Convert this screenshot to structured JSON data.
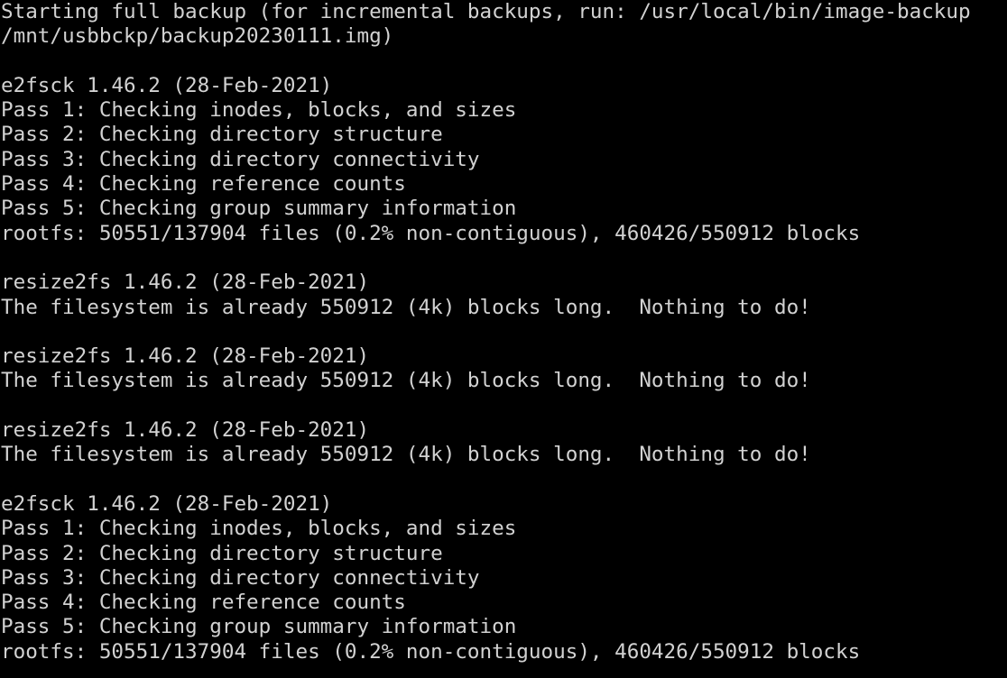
{
  "terminal": {
    "background_color": "#000000",
    "foreground_color": "#d2d2d2",
    "lines": [
      {
        "id": "backup-header-1",
        "text": "Starting full backup (for incremental backups, run: /usr/local/bin/image-backup"
      },
      {
        "id": "backup-header-2",
        "text": "/mnt/usbbckp/backup20230111.img)"
      },
      {
        "id": "blank-1",
        "text": ""
      },
      {
        "id": "e2fsck-version-1",
        "text": "e2fsck 1.46.2 (28-Feb-2021)"
      },
      {
        "id": "e2fsck1-pass-1",
        "text": "Pass 1: Checking inodes, blocks, and sizes"
      },
      {
        "id": "e2fsck1-pass-2",
        "text": "Pass 2: Checking directory structure"
      },
      {
        "id": "e2fsck1-pass-3",
        "text": "Pass 3: Checking directory connectivity"
      },
      {
        "id": "e2fsck1-pass-4",
        "text": "Pass 4: Checking reference counts"
      },
      {
        "id": "e2fsck1-pass-5",
        "text": "Pass 5: Checking group summary information"
      },
      {
        "id": "e2fsck1-summary",
        "text": "rootfs: 50551/137904 files (0.2% non-contiguous), 460426/550912 blocks"
      },
      {
        "id": "blank-2",
        "text": ""
      },
      {
        "id": "resize2fs-version-1",
        "text": "resize2fs 1.46.2 (28-Feb-2021)"
      },
      {
        "id": "resize2fs-result-1",
        "text": "The filesystem is already 550912 (4k) blocks long.  Nothing to do!"
      },
      {
        "id": "blank-3",
        "text": ""
      },
      {
        "id": "resize2fs-version-2",
        "text": "resize2fs 1.46.2 (28-Feb-2021)"
      },
      {
        "id": "resize2fs-result-2",
        "text": "The filesystem is already 550912 (4k) blocks long.  Nothing to do!"
      },
      {
        "id": "blank-4",
        "text": ""
      },
      {
        "id": "resize2fs-version-3",
        "text": "resize2fs 1.46.2 (28-Feb-2021)"
      },
      {
        "id": "resize2fs-result-3",
        "text": "The filesystem is already 550912 (4k) blocks long.  Nothing to do!"
      },
      {
        "id": "blank-5",
        "text": ""
      },
      {
        "id": "e2fsck-version-2",
        "text": "e2fsck 1.46.2 (28-Feb-2021)"
      },
      {
        "id": "e2fsck2-pass-1",
        "text": "Pass 1: Checking inodes, blocks, and sizes"
      },
      {
        "id": "e2fsck2-pass-2",
        "text": "Pass 2: Checking directory structure"
      },
      {
        "id": "e2fsck2-pass-3",
        "text": "Pass 3: Checking directory connectivity"
      },
      {
        "id": "e2fsck2-pass-4",
        "text": "Pass 4: Checking reference counts"
      },
      {
        "id": "e2fsck2-pass-5",
        "text": "Pass 5: Checking group summary information"
      },
      {
        "id": "e2fsck2-summary",
        "text": "rootfs: 50551/137904 files (0.2% non-contiguous), 460426/550912 blocks"
      }
    ]
  }
}
